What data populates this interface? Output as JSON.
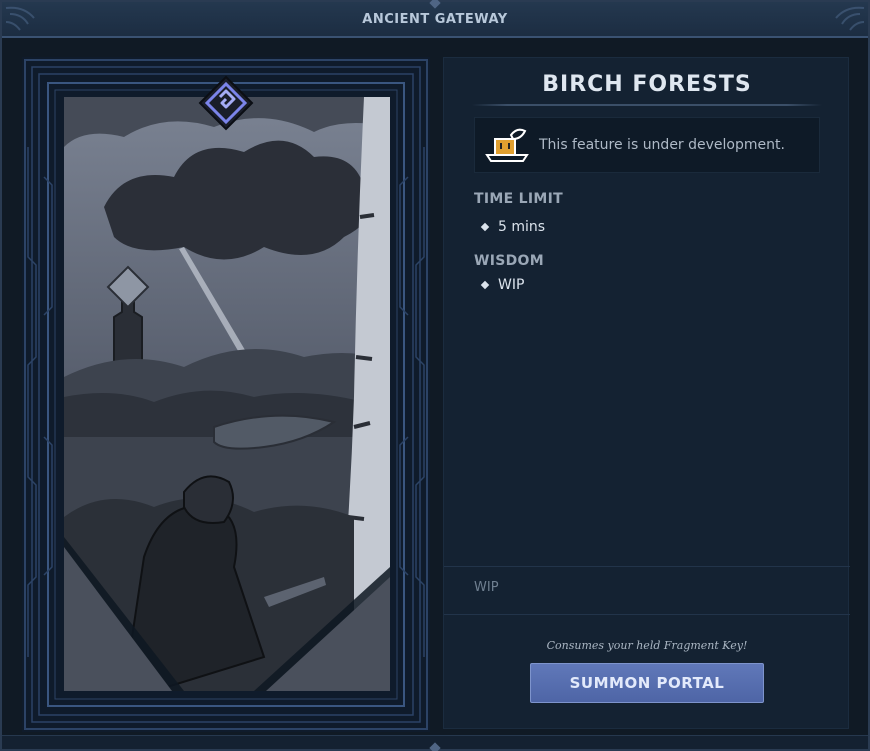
{
  "window": {
    "title": "ANCIENT GATEWAY"
  },
  "card": {
    "emblem_icon": "portal-rune-icon",
    "art": "birch-forest-scene"
  },
  "info": {
    "title": "BIRCH FORESTS",
    "notice": {
      "icon": "under-construction-icon",
      "text": "This feature is under development."
    },
    "sections": [
      {
        "label": "TIME LIMIT",
        "items": [
          "5 mins"
        ]
      },
      {
        "label": "WISDOM",
        "items": [
          "WIP"
        ]
      }
    ],
    "footer_text": "WIP",
    "consume_note": "Consumes your held Fragment Key!",
    "summon_button": "SUMMON PORTAL"
  },
  "colors": {
    "accent": "#5a72b4",
    "panel": "#142232",
    "frame": "#2a3b52"
  }
}
